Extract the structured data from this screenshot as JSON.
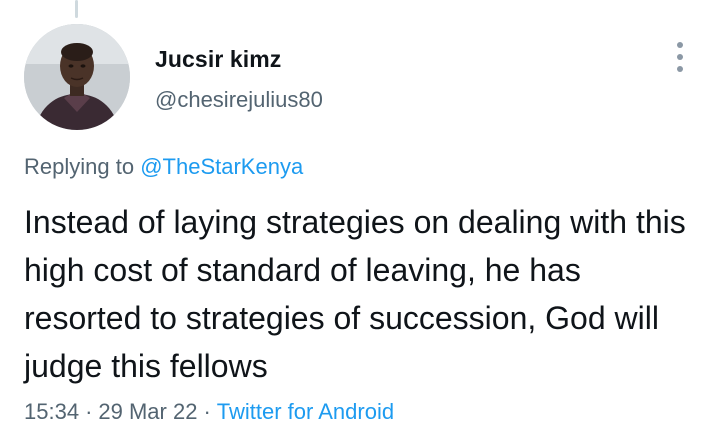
{
  "tweet": {
    "author": {
      "display_name": "Jucsir kimz",
      "handle": "@chesirejulius80"
    },
    "reply": {
      "prefix": "Replying to",
      "mention": "@TheStarKenya"
    },
    "text": "Instead of laying strategies on dealing with this high cost of standard of leaving, he has resorted to strategies of succession, God will judge this fellows",
    "time": "15:34",
    "date": "29 Mar 22",
    "separator": "·",
    "source": "Twitter for Android"
  },
  "icons": {
    "more": "more-vertical-icon",
    "avatar": "profile-photo"
  },
  "colors": {
    "link": "#1d9bf0",
    "secondary_text": "#536471",
    "primary_text": "#0f1419"
  }
}
